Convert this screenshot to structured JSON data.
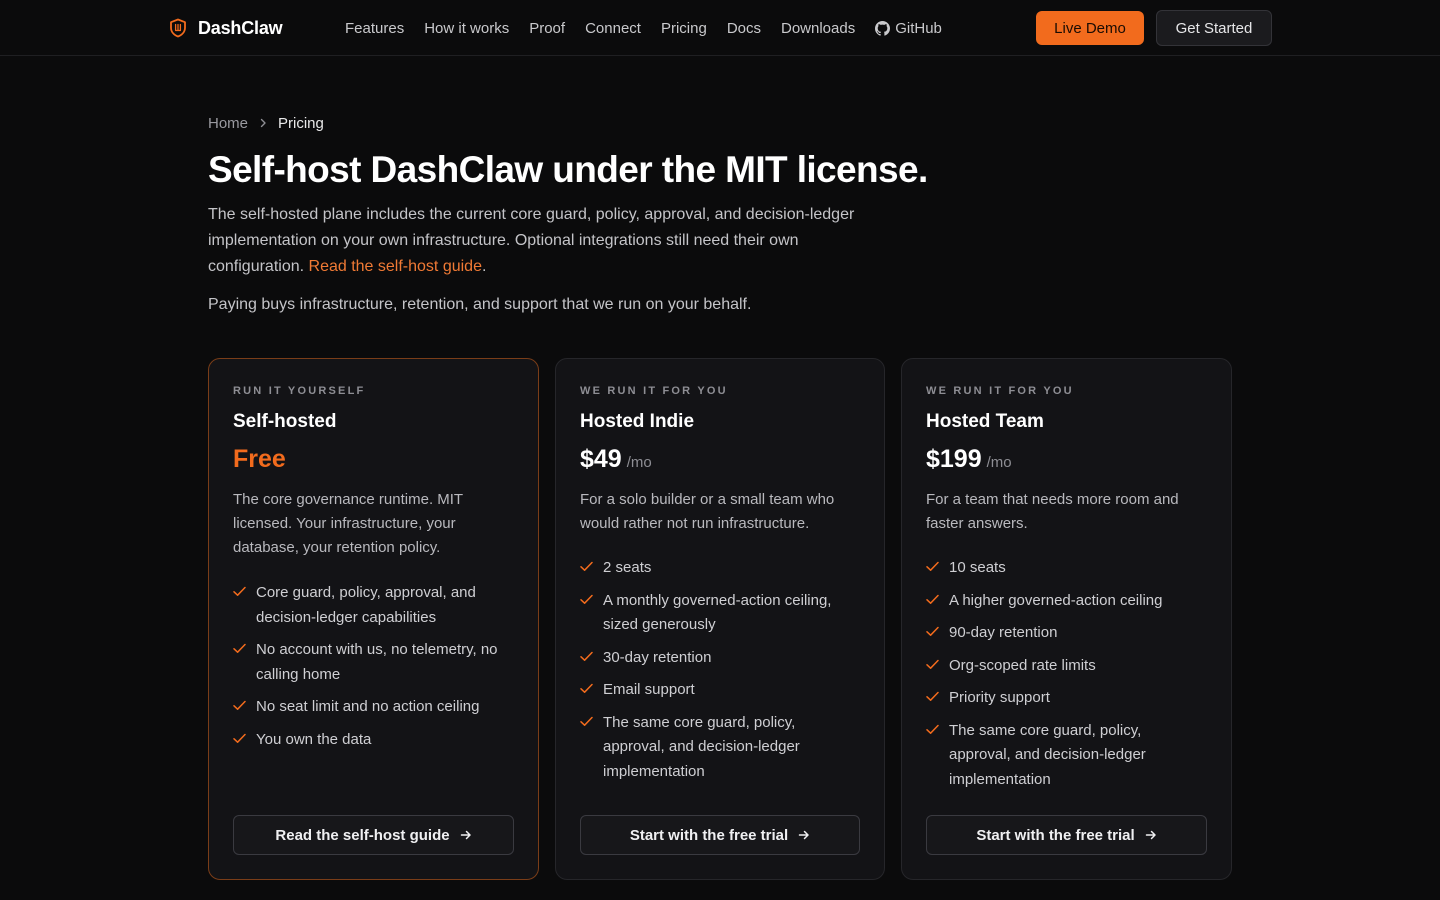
{
  "nav": {
    "brand": "DashClaw",
    "links": [
      "Features",
      "How it works",
      "Proof",
      "Connect",
      "Pricing",
      "Docs",
      "Downloads",
      "GitHub"
    ],
    "live_demo": "Live Demo",
    "get_started": "Get Started"
  },
  "breadcrumb": {
    "home": "Home",
    "current": "Pricing"
  },
  "hero": {
    "title": "Self-host DashClaw under the MIT license.",
    "intro": "The self-hosted plane includes the current core guard, policy, approval, and decision-ledger implementation on your own infrastructure. Optional integrations still need their own configuration.",
    "intro_link": "Read the self-host guide",
    "intro_end": ".",
    "subintro": "Paying buys infrastructure, retention, and support that we run on your behalf."
  },
  "plans": [
    {
      "eyebrow": "RUN IT YOURSELF",
      "name": "Self-hosted",
      "price": "Free",
      "period": "",
      "description": "The core governance runtime. MIT licensed. Your infrastructure, your database, your retention policy.",
      "features": [
        "Core guard, policy, approval, and decision-ledger capabilities",
        "No account with us, no telemetry, no calling home",
        "No seat limit and no action ceiling",
        "You own the data"
      ],
      "cta": "Read the self-host guide"
    },
    {
      "eyebrow": "WE RUN IT FOR YOU",
      "name": "Hosted Indie",
      "price": "$49",
      "period": "/mo",
      "description": "For a solo builder or a small team who would rather not run infrastructure.",
      "features": [
        "2 seats",
        "A monthly governed-action ceiling, sized generously",
        "30-day retention",
        "Email support",
        "The same core guard, policy, approval, and decision-ledger implementation"
      ],
      "cta": "Start with the free trial"
    },
    {
      "eyebrow": "WE RUN IT FOR YOU",
      "name": "Hosted Team",
      "price": "$199",
      "period": "/mo",
      "description": "For a team that needs more room and faster answers.",
      "features": [
        "10 seats",
        "A higher governed-action ceiling",
        "90-day retention",
        "Org-scoped rate limits",
        "Priority support",
        "The same core guard, policy, approval, and decision-ledger implementation"
      ],
      "cta": "Start with the free trial"
    }
  ],
  "colors": {
    "accent": "#f26b1d",
    "background": "#0b0b0c",
    "card": "#131316",
    "featured_border": "#7a3d18"
  }
}
